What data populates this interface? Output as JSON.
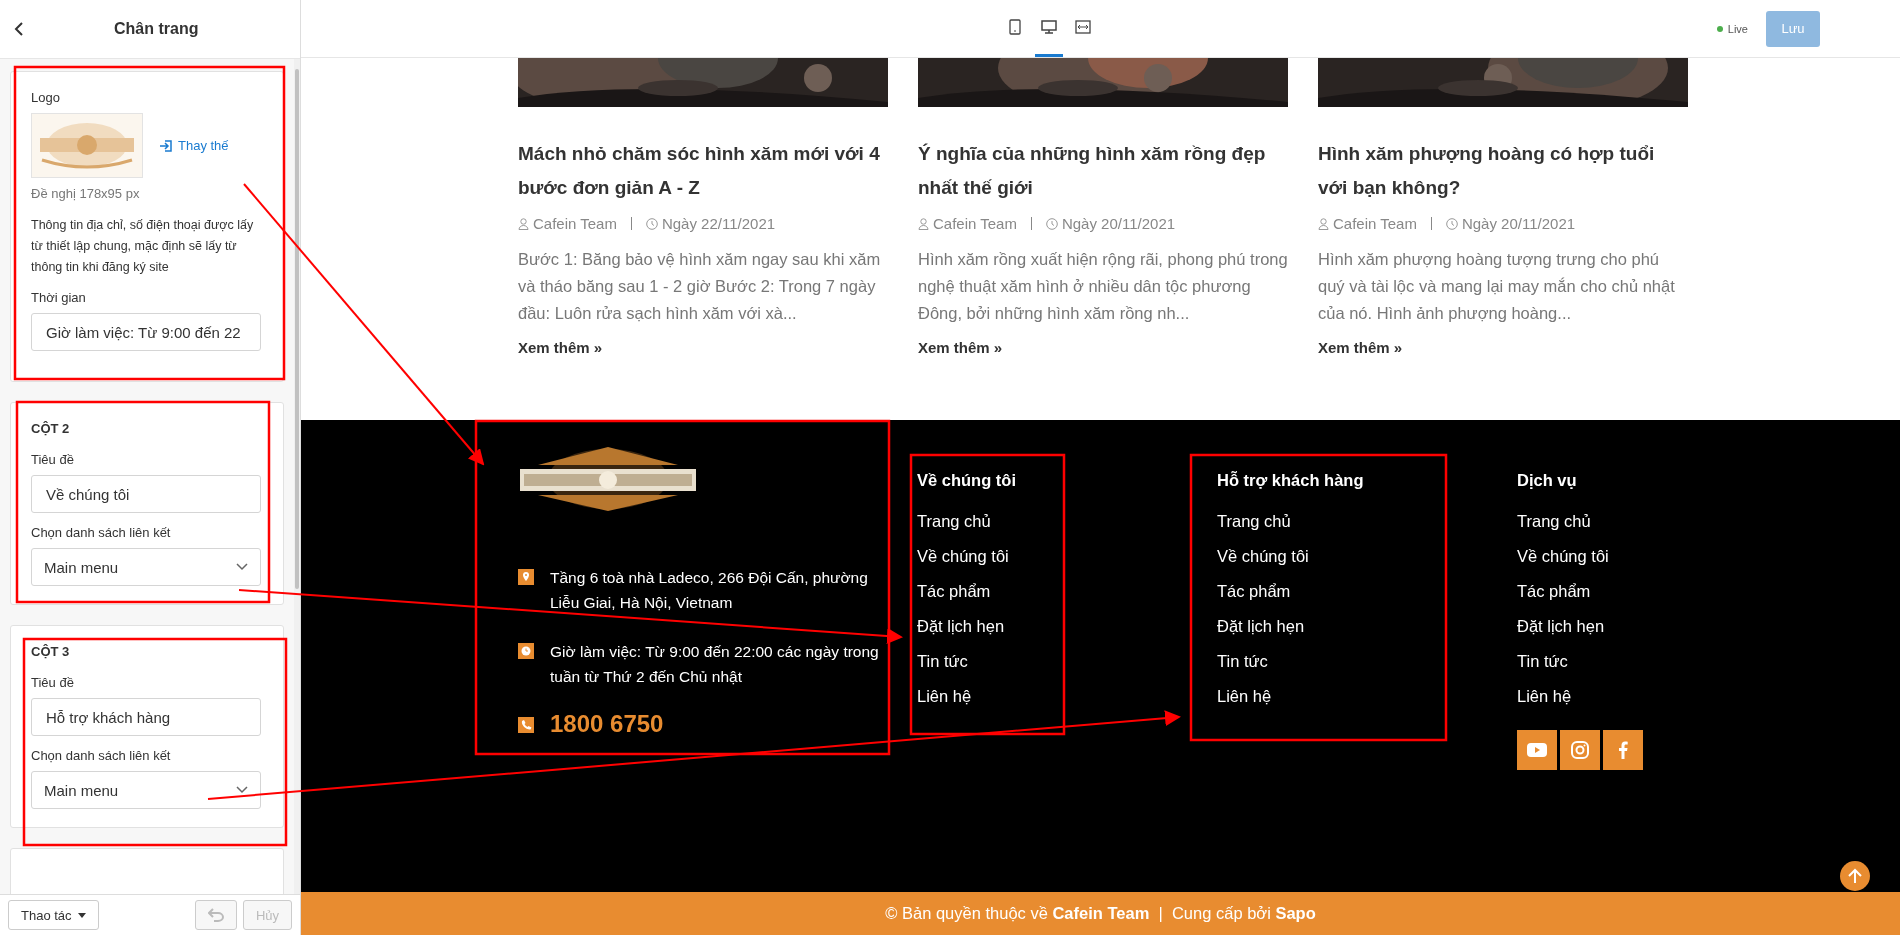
{
  "sidebar": {
    "title": "Chân trang",
    "sections": [
      {
        "kind": "logo",
        "label": "Logo",
        "replace_link": "Thay thế",
        "hint": "Đề nghị 178x95 px",
        "note": "Thông tin địa chỉ, số điện thoại được lấy từ thiết lập chung, mặc định sẽ lấy từ thông tin khi đăng ký site",
        "field_label": "Thời gian",
        "value": "Giờ làm việc: Từ 9:00 đến 22"
      },
      {
        "kind": "column",
        "heading": "CỘT 2",
        "title_label": "Tiêu đề",
        "title_value": "Về chúng tôi",
        "menu_label": "Chọn danh sách liên kết",
        "menu_value": "Main menu"
      },
      {
        "kind": "column",
        "heading": "CỘT 3",
        "title_label": "Tiêu đề",
        "title_value": "Hỗ trợ khách hàng",
        "menu_label": "Chọn danh sách liên kết",
        "menu_value": "Main menu"
      },
      {
        "kind": "collapsed"
      }
    ],
    "actions_button": "Thao tác",
    "undo": {
      "disabled": true
    },
    "cancel": {
      "label": "Hủy",
      "disabled": true
    }
  },
  "toolbar": {
    "devices": [
      {
        "kind": "mobile",
        "selected": false
      },
      {
        "kind": "desktop",
        "selected": true
      },
      {
        "kind": "fullwidth",
        "selected": false
      }
    ],
    "status": "Live",
    "save": {
      "label": "Lưu",
      "disabled": true
    }
  },
  "posts": [
    {
      "title": "Mách nhỏ chăm sóc hình xăm mới với 4 bước đơn giản A - Z",
      "author": "Cafein Team",
      "date": "Ngày 22/11/2021",
      "excerpt": "Bước 1: Băng bảo vệ hình xăm ngay sau khi xăm và tháo băng sau 1 - 2 giờ Bước 2: Trong 7 ngày đầu: Luôn rửa sạch hình xăm với xà...",
      "more": "Xem thêm »"
    },
    {
      "title": "Ý nghĩa của những hình xăm rồng đẹp nhất thế giới",
      "author": "Cafein Team",
      "date": "Ngày 20/11/2021",
      "excerpt": "Hình xăm rồng xuất hiện rộng rãi, phong phú trong nghệ thuật xăm hình ở nhiều dân tộc phương Đông, bởi những hình xăm rồng nh...",
      "more": "Xem thêm »"
    },
    {
      "title": "Hình xăm phượng hoàng có hợp tuổi với bạn không?",
      "author": "Cafein Team",
      "date": "Ngày 20/11/2021",
      "excerpt": "Hình xăm phượng hoàng tượng trưng cho phú quý và tài lộc và mang lại may mắn cho chủ nhật của nó. Hình ảnh phượng hoàng...",
      "more": "Xem thêm »"
    }
  ],
  "footer": {
    "contacts": [
      {
        "kind": "address",
        "text": "Tầng 6 toà nhà Ladeco, 266 Đội Cấn, phường Liễu Giai, Hà Nội, Vietnam"
      },
      {
        "kind": "hours",
        "text": "Giờ làm việc: Từ 9:00 đến 22:00 các ngày trong tuần từ Thứ 2 đến Chủ nhật"
      },
      {
        "kind": "phone",
        "text": "1800 6750"
      }
    ],
    "columns": [
      {
        "heading": "Về chúng tôi",
        "links": [
          "Trang chủ",
          "Về chúng tôi",
          "Tác phẩm",
          "Đặt lịch hẹn",
          "Tin tức",
          "Liên hệ"
        ]
      },
      {
        "heading": "Hỗ trợ khách hàng",
        "links": [
          "Trang chủ",
          "Về chúng tôi",
          "Tác phẩm",
          "Đặt lịch hẹn",
          "Tin tức",
          "Liên hệ"
        ]
      },
      {
        "heading": "Dịch vụ",
        "links": [
          "Trang chủ",
          "Về chúng tôi",
          "Tác phẩm",
          "Đặt lịch hẹn",
          "Tin tức",
          "Liên hệ"
        ],
        "socials": [
          {
            "kind": "youtube"
          },
          {
            "kind": "instagram"
          },
          {
            "kind": "facebook"
          }
        ]
      }
    ],
    "copyright": "© Bản quyền thuộc về **Cafein Team**  |  Cung cấp bởi **Sapo**"
  }
}
